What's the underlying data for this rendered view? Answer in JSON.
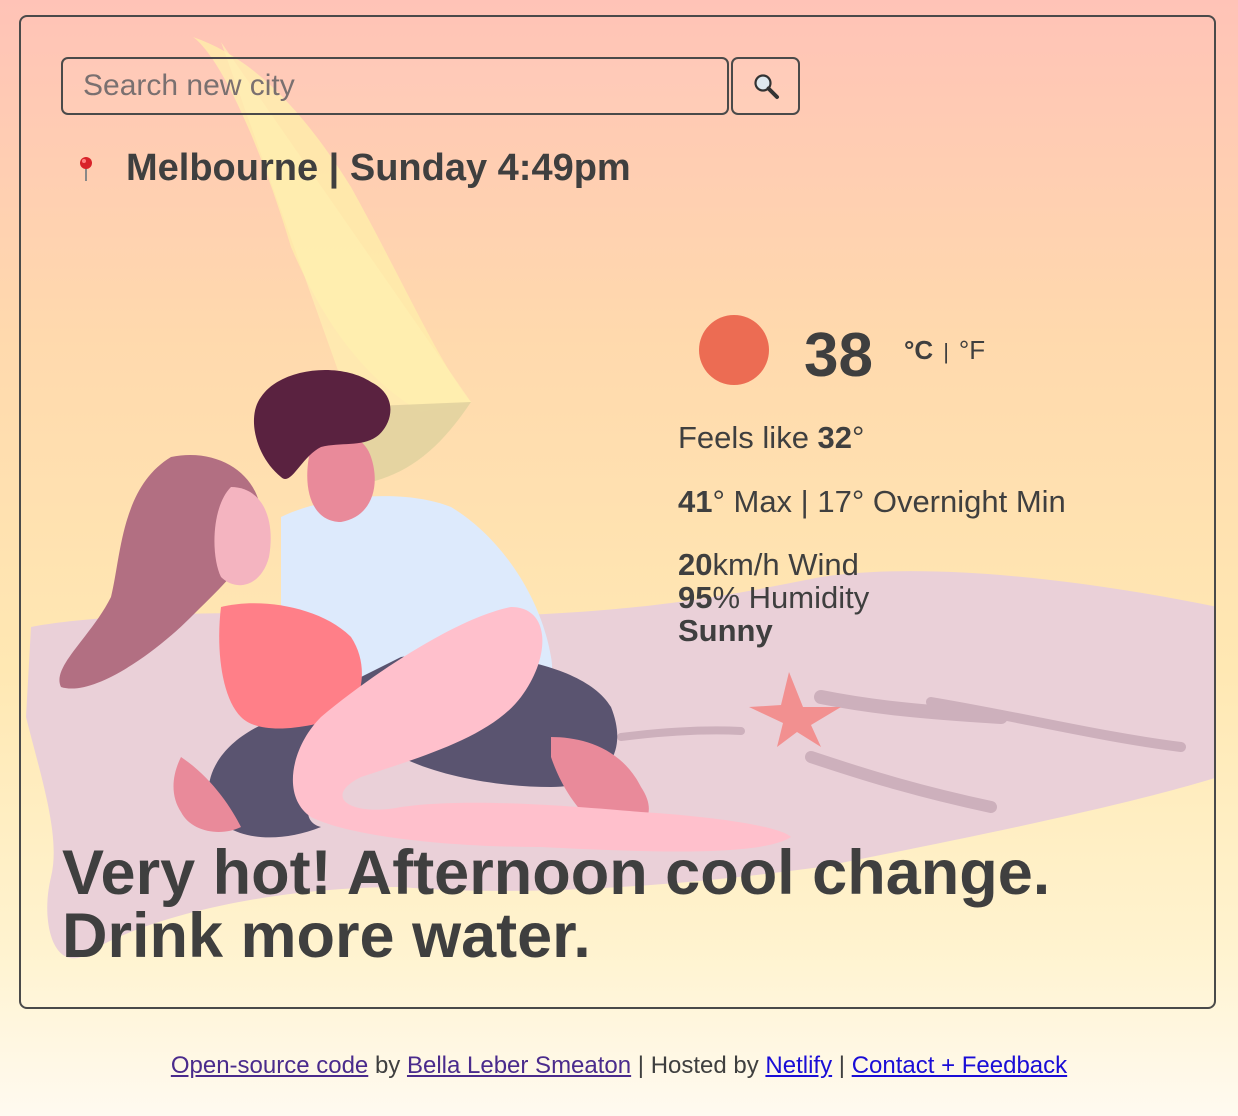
{
  "search": {
    "placeholder": "Search new city",
    "button_icon": "magnifier-icon"
  },
  "location": {
    "icon": "pin-icon",
    "text": "Melbourne | Sunday 4:49pm"
  },
  "current": {
    "icon": "sun-icon",
    "temperature": "38",
    "unit_c": "°C",
    "unit_sep": "|",
    "unit_f": "°F"
  },
  "details": {
    "feels_label": "Feels like ",
    "feels_value": "32",
    "feels_suffix": "°",
    "max_value": "41",
    "max_suffix": "° Max | 17° Overnight Min",
    "wind_value": "20",
    "wind_suffix": "km/h Wind",
    "humidity_value": "95",
    "humidity_suffix": "% Humidity",
    "condition": "Sunny"
  },
  "summary": {
    "line1": "Very hot! Afternoon cool change.",
    "line2": "Drink more water."
  },
  "footer": {
    "source_link": "Open-source code",
    "by": " by ",
    "author_link": "Bella Leber Smeaton",
    "hosted": " | Hosted by ",
    "host_link": "Netlify",
    "sep": " | ",
    "contact_link": "Contact + Feedback"
  },
  "colors": {
    "sun": "#ec6c53",
    "text": "#3f3f3f",
    "link_visited": "#4a2b8c",
    "link": "#1a0dd6"
  }
}
